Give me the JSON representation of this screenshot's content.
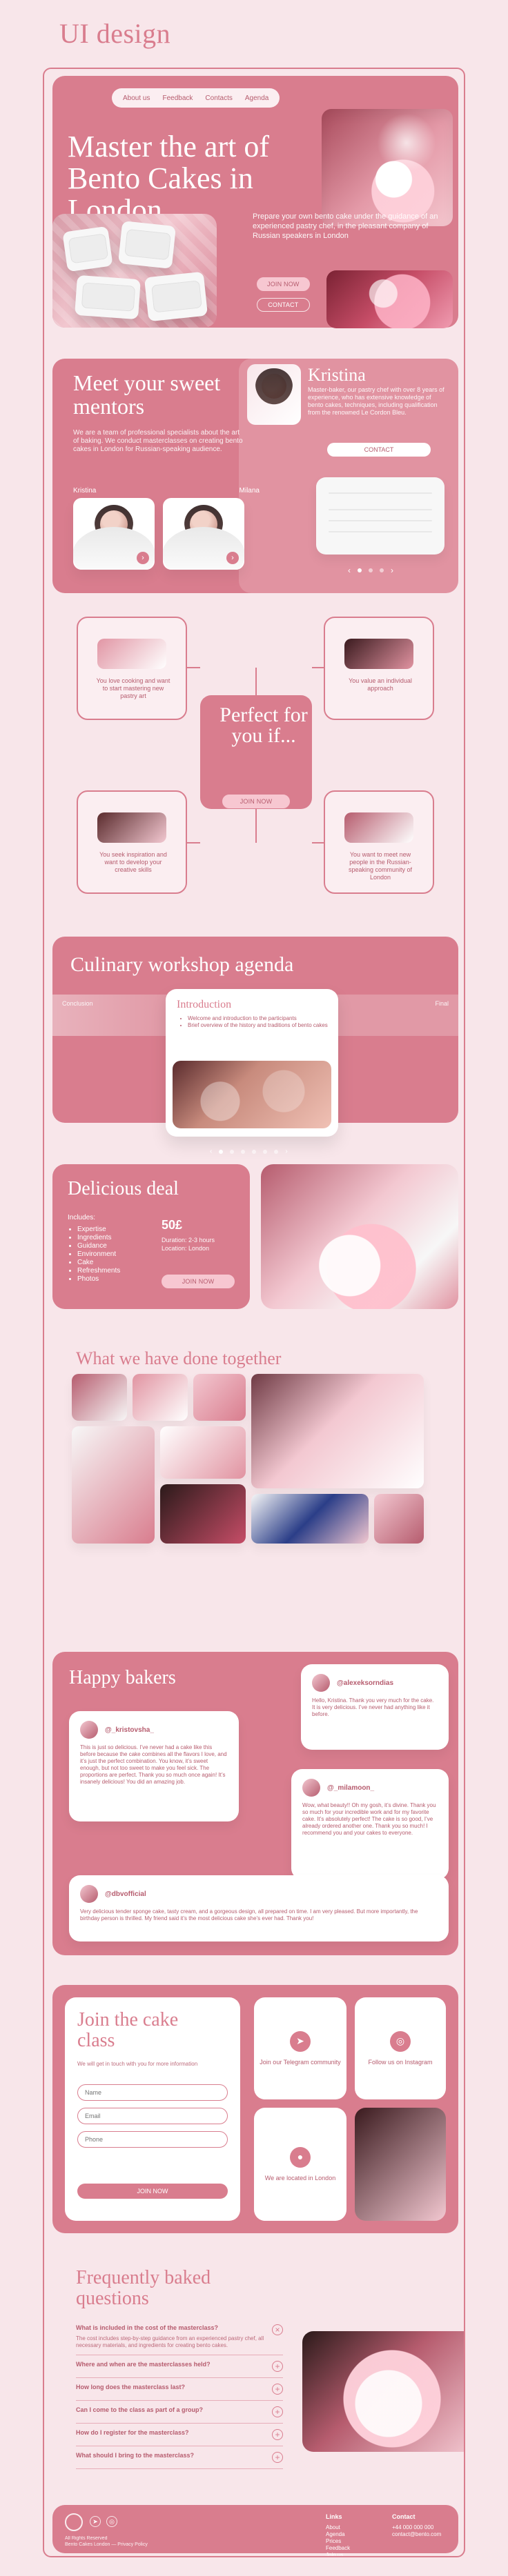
{
  "brand": {
    "title": "UI design"
  },
  "hero": {
    "nav": [
      "About us",
      "Feedback",
      "Contacts",
      "Agenda"
    ],
    "title": "Master the art of Bento Cakes in London",
    "text": "Prepare your own bento cake under the guidance of an experienced pastry chef, in the pleasant company of Russian speakers in London",
    "buttons": {
      "join": "JOIN NOW",
      "contact": "CONTACT"
    }
  },
  "mentors": {
    "title": "Meet your sweet mentors",
    "desc": "We are a team of professional specialists about the art of baking. We conduct masterclasses on creating bento cakes in London for Russian-speaking audience.",
    "names": [
      "Kristina",
      "Milana"
    ],
    "kristina": {
      "name": "Kristina",
      "text": "Master-baker, our pastry chef with over 8 years of experience, who has extensive knowledge of bento cakes, techniques, including qualification from the renowned Le Cordon Bleu.",
      "contact": "CONTACT"
    }
  },
  "perfect": {
    "title": "Perfect for you if...",
    "cards": [
      "You love cooking and want to start mastering new pastry art",
      "You value an individual approach",
      "You seek inspiration and want to develop your creative skills",
      "You want to meet new people in the Russian-speaking community of London"
    ],
    "button": "JOIN NOW"
  },
  "agenda": {
    "title": "Culinary workshop agenda",
    "side_left": "Conclusion",
    "side_right": "Final",
    "card": {
      "title": "Introduction",
      "items": [
        "Welcome and introduction to the participants",
        "Brief overview of the history and traditions of bento cakes"
      ]
    }
  },
  "deal": {
    "title": "Delicious deal",
    "includes_label": "Includes:",
    "includes": [
      "Expertise",
      "Ingredients",
      "Guidance",
      "Environment",
      "Cake",
      "Refreshments",
      "Photos"
    ],
    "price": "50£",
    "meta": [
      "Duration: 2-3 hours",
      "Location: London"
    ],
    "button": "JOIN NOW"
  },
  "gallery": {
    "title": "What we have done together"
  },
  "happy": {
    "title": "Happy bakers",
    "reviews": [
      {
        "user": "@alexeksorndias",
        "text": "Hello, Kristina. Thank you very much for the cake. It is very delicious. I’ve never had anything like it before."
      },
      {
        "user": "@_kristovsha_",
        "text": "This is just so delicious. I’ve never had a cake like this before because the cake combines all the flavors I love, and it’s just the perfect combination. You know, it’s sweet enough, but not too sweet to make you feel sick. The proportions are perfect. Thank you so much once again! It’s insanely delicious! You did an amazing job."
      },
      {
        "user": "@_milamoon_",
        "text": "Wow, what beauty!! Oh my gosh, it’s divine. Thank you so much for your incredible work and for my favorite cake. It’s absolutely perfect! The cake is so good, I’ve already ordered another one. Thank you so much! I recommend you and your cakes to everyone."
      },
      {
        "user": "@dbvofficial",
        "text": "Very delicious tender sponge cake, tasty cream, and a gorgeous design, all prepared on time. I am very pleased. But more importantly, the birthday person is thrilled. My friend said it’s the most delicious cake she’s ever had. Thank you!"
      }
    ]
  },
  "join": {
    "title": "Join the cake class",
    "sub": "We will get in touch with you for more information",
    "inputs": [
      "Name",
      "Email",
      "Phone"
    ],
    "button": "JOIN NOW",
    "tiles": [
      {
        "label": "Join our Telegram community"
      },
      {
        "label": "Follow us on Instagram"
      },
      {
        "label": "We are located in London"
      }
    ]
  },
  "faq": {
    "title": "Frequently baked questions",
    "items": [
      {
        "q": "What is included in the cost of the masterclass?",
        "a": "The cost includes step-by-step guidance from an experienced pastry chef, all necessary materials, and ingredients for creating bento cakes."
      },
      {
        "q": "Where and when are the masterclasses held?",
        "a": ""
      },
      {
        "q": "How long does the masterclass last?",
        "a": ""
      },
      {
        "q": "Can I come to the class as part of a group?",
        "a": ""
      },
      {
        "q": "How do I register for the masterclass?",
        "a": ""
      },
      {
        "q": "What should I bring to the masterclass?",
        "a": ""
      }
    ]
  },
  "footer": {
    "copyright": "All Rights Reserved",
    "small": "Bento Cakes London — Privacy Policy",
    "links": [
      "About",
      "Agenda",
      "Prices",
      "Feedback",
      "Join us"
    ],
    "contact": [
      "+44 000 000 000",
      "contact@bento.com"
    ],
    "links_title": "Links",
    "contact_title": "Contact"
  },
  "colors": {
    "accent": "#d97d8e",
    "background": "#f8e6ea"
  }
}
